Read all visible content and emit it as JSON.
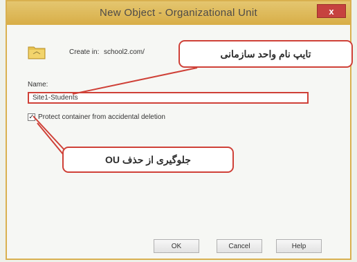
{
  "window": {
    "title": "New Object - Organizational Unit",
    "close_symbol": "x"
  },
  "form": {
    "create_in_label": "Create in:",
    "create_in_path": "school2.com/",
    "name_label": "Name:",
    "name_value": "Site1-Students",
    "protect_label": "Protect container from accidental deletion",
    "protect_checked": true,
    "check_mark": "✓"
  },
  "buttons": {
    "ok": "OK",
    "cancel": "Cancel",
    "help": "Help"
  },
  "annotations": {
    "name_callout": "تایپ نام واحد سازمانی",
    "protect_callout": "جلوگیری از حذف OU"
  },
  "colors": {
    "title_bar": "#d8ae47",
    "highlight": "#cf4037",
    "close_button": "#c6423f"
  },
  "icons": {
    "folder": "ou-folder-icon",
    "close": "close-icon",
    "check": "checkmark-icon"
  }
}
